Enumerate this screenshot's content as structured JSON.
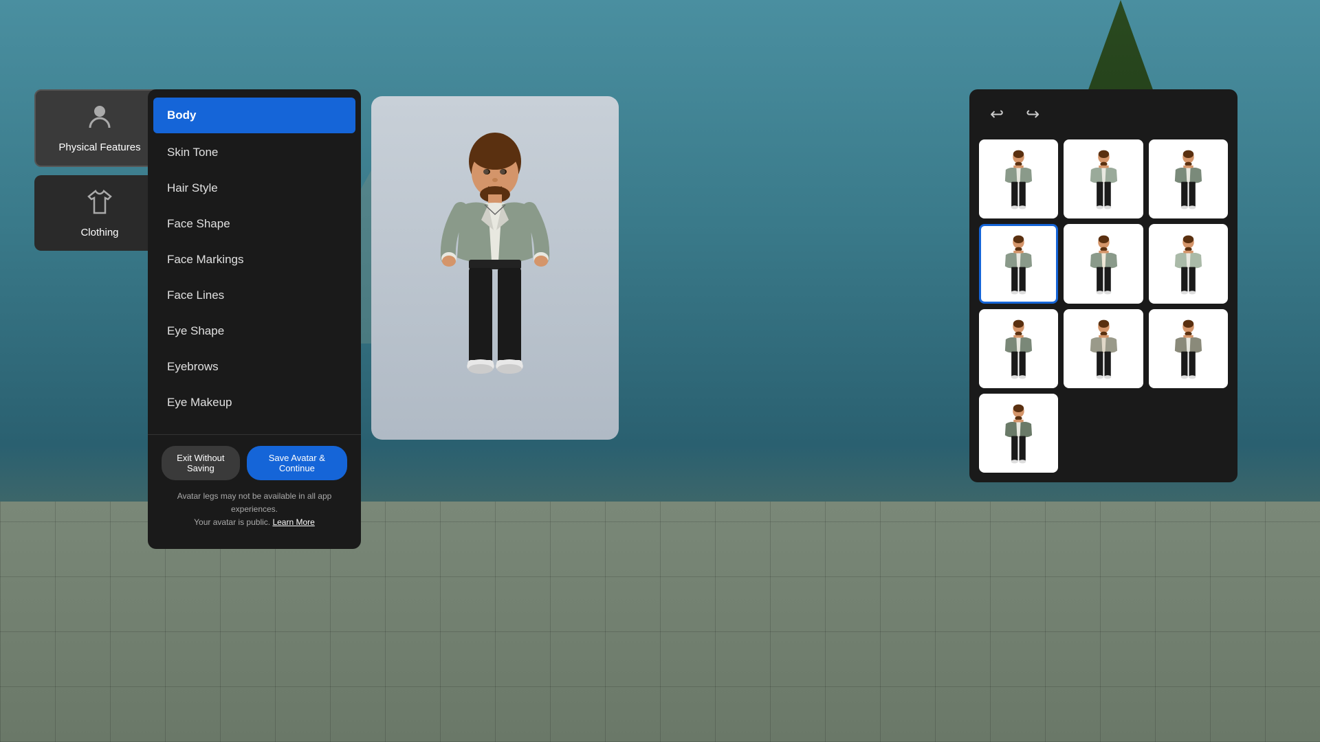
{
  "background": {
    "scene": "VR environment with outdoor setting"
  },
  "leftPanel": {
    "categories": [
      {
        "id": "physical-features",
        "label": "Physical Features",
        "icon": "👤",
        "active": true
      },
      {
        "id": "clothing",
        "label": "Clothing",
        "icon": "👕",
        "active": false
      }
    ]
  },
  "mainPanel": {
    "menuItems": [
      {
        "id": "body",
        "label": "Body",
        "active": true
      },
      {
        "id": "skin-tone",
        "label": "Skin Tone",
        "active": false
      },
      {
        "id": "hair-style",
        "label": "Hair Style",
        "active": false
      },
      {
        "id": "face-shape",
        "label": "Face Shape",
        "active": false
      },
      {
        "id": "face-markings",
        "label": "Face Markings",
        "active": false
      },
      {
        "id": "face-lines",
        "label": "Face Lines",
        "active": false
      },
      {
        "id": "eye-shape",
        "label": "Eye Shape",
        "active": false
      },
      {
        "id": "eyebrows",
        "label": "Eyebrows",
        "active": false
      },
      {
        "id": "eye-makeup",
        "label": "Eye Makeup",
        "active": false
      }
    ],
    "footer": {
      "exitButton": "Exit Without Saving",
      "saveButton": "Save Avatar & Continue",
      "notice1": "Avatar legs may not be available in all app experiences.",
      "notice2": "Your avatar is public.",
      "learnMore": "Learn More"
    }
  },
  "rightPanel": {
    "toolbar": {
      "undoIcon": "↩",
      "redoIcon": "↪"
    },
    "styleGrid": [
      {
        "id": 1,
        "selected": false
      },
      {
        "id": 2,
        "selected": false
      },
      {
        "id": 3,
        "selected": false
      },
      {
        "id": 4,
        "selected": true
      },
      {
        "id": 5,
        "selected": false
      },
      {
        "id": 6,
        "selected": false
      },
      {
        "id": 7,
        "selected": false
      },
      {
        "id": 8,
        "selected": false
      },
      {
        "id": 9,
        "selected": false
      },
      {
        "id": 10,
        "selected": false
      }
    ]
  },
  "colors": {
    "accent": "#1565d8",
    "panelBg": "#1a1a1a",
    "activeMenu": "#1565d8",
    "buttonExit": "#3a3a3a",
    "buttonSave": "#1565d8",
    "selectedBorder": "#1565d8"
  }
}
